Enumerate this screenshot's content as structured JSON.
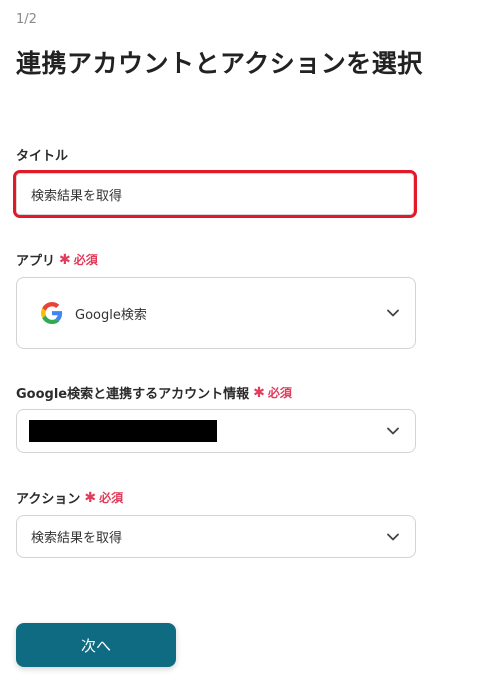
{
  "header": {
    "step": "1/2",
    "title": "連携アカウントとアクションを選択"
  },
  "title_field": {
    "label": "タイトル",
    "value": "検索結果を取得"
  },
  "app_field": {
    "label": "アプリ",
    "required": "必須",
    "value": "Google検索",
    "icon": "google-icon"
  },
  "account_field": {
    "label": "Google検索と連携するアカウント情報",
    "required": "必須",
    "value_redacted": true
  },
  "action_field": {
    "label": "アクション",
    "required": "必須",
    "value": "検索結果を取得"
  },
  "footer": {
    "next_label": "次へ"
  },
  "colors": {
    "primary": "#0e6b82",
    "required": "#e23b5b",
    "highlight": "#e3192a"
  }
}
